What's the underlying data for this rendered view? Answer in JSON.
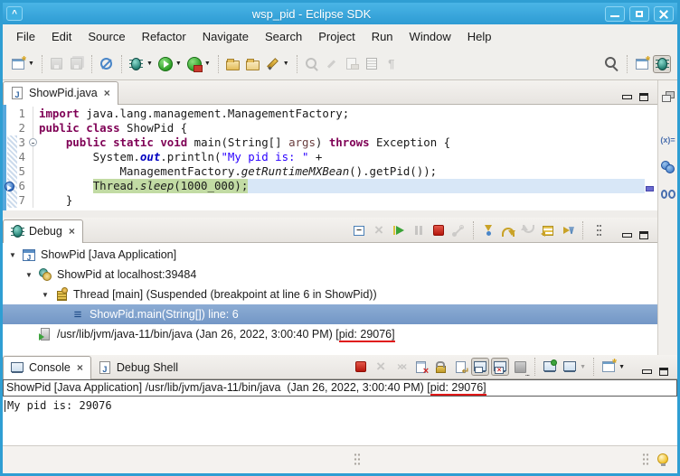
{
  "window": {
    "title": "wsp_pid - Eclipse SDK"
  },
  "titlebar": {
    "buttons": [
      "minimize",
      "maximize",
      "close"
    ]
  },
  "menu": {
    "items": [
      "File",
      "Edit",
      "Source",
      "Refactor",
      "Navigate",
      "Search",
      "Project",
      "Run",
      "Window",
      "Help"
    ]
  },
  "main_toolbar": {
    "items": [
      {
        "icon": "new-wizard",
        "chevron": true
      },
      {
        "sep": true
      },
      {
        "icon": "save",
        "disabled": true
      },
      {
        "icon": "save-all",
        "disabled": true
      },
      {
        "sep": true
      },
      {
        "icon": "skip-all-breakpoints"
      },
      {
        "sep": true
      },
      {
        "icon": "debug",
        "chevron": true
      },
      {
        "icon": "run",
        "chevron": true
      },
      {
        "icon": "run-external-tools",
        "chevron": true
      },
      {
        "sep": true
      },
      {
        "icon": "open-type"
      },
      {
        "icon": "open-resource"
      },
      {
        "icon": "java-search",
        "chevron": true
      },
      {
        "sep": true
      },
      {
        "icon": "last-edit-location",
        "disabled": true
      },
      {
        "icon": "next-annotation",
        "disabled": true
      },
      {
        "icon": "link-with-editor",
        "disabled": true
      },
      {
        "icon": "show-selected-element",
        "disabled": true
      },
      {
        "icon": "show-whitespace",
        "disabled": true
      },
      {
        "spacer": true
      },
      {
        "icon": "search"
      },
      {
        "sep": true
      },
      {
        "icon": "open-perspective"
      },
      {
        "icon": "debug-perspective",
        "pressed": true
      }
    ]
  },
  "editor": {
    "tab": {
      "label": "ShowPid.java",
      "close_glyph": "×"
    },
    "lines": [
      {
        "num": "1",
        "segs": [
          {
            "t": "import",
            "c": "kw"
          },
          {
            "t": " java.lang.management.ManagementFactory;"
          }
        ]
      },
      {
        "num": "2",
        "segs": [
          {
            "t": "public",
            "c": "kw"
          },
          {
            "t": " "
          },
          {
            "t": "class",
            "c": "kw"
          },
          {
            "t": " ShowPid {"
          }
        ]
      },
      {
        "num": "3",
        "fold": true,
        "segs": [
          {
            "t": "    "
          },
          {
            "t": "public",
            "c": "kw"
          },
          {
            "t": " "
          },
          {
            "t": "static",
            "c": "kw"
          },
          {
            "t": " "
          },
          {
            "t": "void",
            "c": "kw"
          },
          {
            "t": " main(String[] "
          },
          {
            "t": "args",
            "c": "param"
          },
          {
            "t": ") "
          },
          {
            "t": "throws",
            "c": "kw"
          },
          {
            "t": " Exception {"
          }
        ]
      },
      {
        "num": "4",
        "segs": [
          {
            "t": "        System."
          },
          {
            "t": "out",
            "c": "sfield"
          },
          {
            "t": ".println("
          },
          {
            "t": "\"My pid is: \"",
            "c": "str"
          },
          {
            "t": " +"
          }
        ]
      },
      {
        "num": "5",
        "segs": [
          {
            "t": "            ManagementFactory."
          },
          {
            "t": "getRuntimeMXBean",
            "c": "smethod"
          },
          {
            "t": "().getPid());"
          }
        ]
      },
      {
        "num": "6",
        "breakpoint": true,
        "current": true,
        "segs": [
          {
            "t": "        "
          },
          {
            "t": "Thread.",
            "g": true
          },
          {
            "t": "sleep",
            "c": "smethod",
            "g": true
          },
          {
            "t": "(1000_000);",
            "g": true
          },
          {
            "tail": true
          }
        ]
      },
      {
        "num": "7",
        "segs": [
          {
            "t": "    }"
          }
        ]
      }
    ]
  },
  "debug_view": {
    "tab": {
      "label": "Debug",
      "close_glyph": "×"
    },
    "toolbar": [
      {
        "icon": "collapse-all"
      },
      {
        "icon": "remove-all-terminated",
        "disabled": true
      },
      {
        "icon": "resume"
      },
      {
        "icon": "suspend",
        "disabled": true
      },
      {
        "icon": "terminate"
      },
      {
        "icon": "disconnect",
        "disabled": true
      },
      {
        "sep": true
      },
      {
        "icon": "step-into"
      },
      {
        "icon": "step-over"
      },
      {
        "icon": "step-return",
        "disabled": true
      },
      {
        "icon": "drop-to-frame"
      },
      {
        "icon": "use-step-filters"
      },
      {
        "sep": true
      },
      {
        "icon": "view-menu"
      }
    ],
    "tree": [
      {
        "level": 1,
        "expanded": true,
        "icon": "java-application",
        "text": "ShowPid [Java Application]"
      },
      {
        "level": 2,
        "expanded": true,
        "icon": "jvm-target",
        "text": "ShowPid at localhost:39484"
      },
      {
        "level": 3,
        "expanded": true,
        "icon": "suspended-thread",
        "text": "Thread [main] (Suspended (breakpoint at line 6 in ShowPid))"
      },
      {
        "level": 4,
        "icon": "stack-frame",
        "text": "ShowPid.main(String[]) line: 6",
        "selected": true
      },
      {
        "level": 2,
        "icon": "process",
        "text_before": "/usr/lib/jvm/java-11/bin/java (Jan 26, 2022, 3:00:40 PM) [",
        "text_underlined": "pid: 29076]"
      }
    ]
  },
  "console": {
    "tabs": [
      {
        "label": "Console",
        "icon": "console",
        "active": true,
        "close_glyph": "×"
      },
      {
        "label": "Debug Shell",
        "icon": "debug-shell"
      }
    ],
    "toolbar": [
      {
        "icon": "terminate"
      },
      {
        "icon": "remove-launch",
        "disabled": true
      },
      {
        "icon": "remove-all-launches",
        "disabled": true
      },
      {
        "icon": "clear-console"
      },
      {
        "icon": "scroll-lock"
      },
      {
        "icon": "word-wrap"
      },
      {
        "icon": "show-stdout",
        "pressed": true
      },
      {
        "icon": "show-stderr",
        "pressed": true
      },
      {
        "icon": "save-output"
      },
      {
        "sep": true
      },
      {
        "icon": "pin-console"
      },
      {
        "icon": "display-console",
        "chevron": "dim"
      },
      {
        "sep": true
      },
      {
        "icon": "open-console",
        "chevron": true
      }
    ],
    "header": {
      "text_before": "ShowPid [Java Application] /usr/lib/jvm/java-11/bin/java  (Jan 26, 2022, 3:00:40 PM) [",
      "text_underlined": "pid: 29076]"
    },
    "output": "My pid is: 29076"
  },
  "right_rail": {
    "icons": [
      "restore-view",
      "variables",
      "breakpoints",
      "expressions"
    ]
  },
  "colors": {
    "titlebar_blue": "#2f9ed3",
    "debug_current_line_green": "#c2dba4",
    "selection_blue": "#7397c6",
    "annotation_red": "#e01818"
  }
}
